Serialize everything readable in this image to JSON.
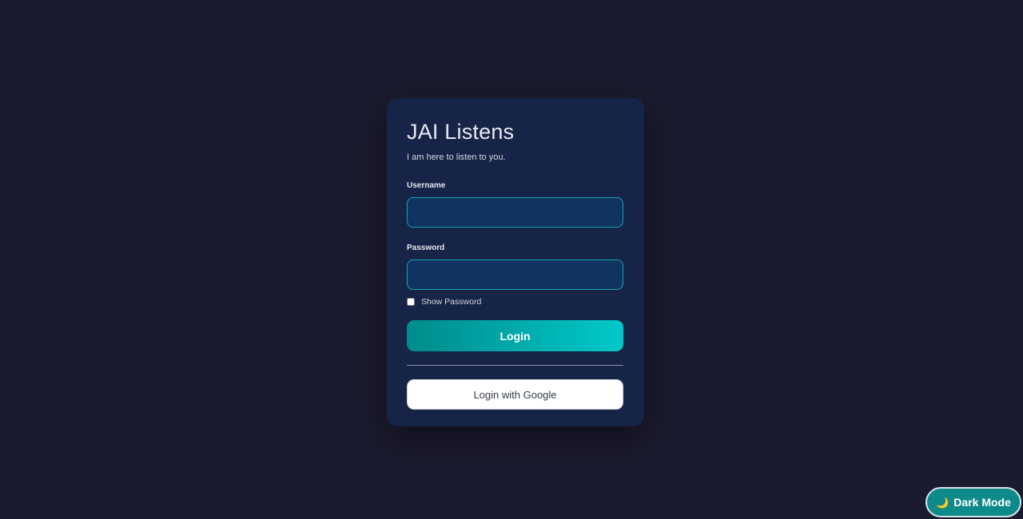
{
  "login_card": {
    "title": "JAI Listens",
    "subtitle": "I am here to listen to you.",
    "username_label": "Username",
    "username_value": "",
    "password_label": "Password",
    "password_value": "",
    "show_password_label": "Show Password",
    "show_password_checked": false,
    "login_label": "Login",
    "google_login_label": "Login with Google"
  },
  "theme_toggle": {
    "label": "Dark Mode",
    "icon": "moon-icon"
  },
  "colors": {
    "background": "#1b1b2f",
    "card": "#162447",
    "input_bg": "#10335f",
    "accent": "#00c9c9",
    "accent_dark": "#008b8b"
  }
}
